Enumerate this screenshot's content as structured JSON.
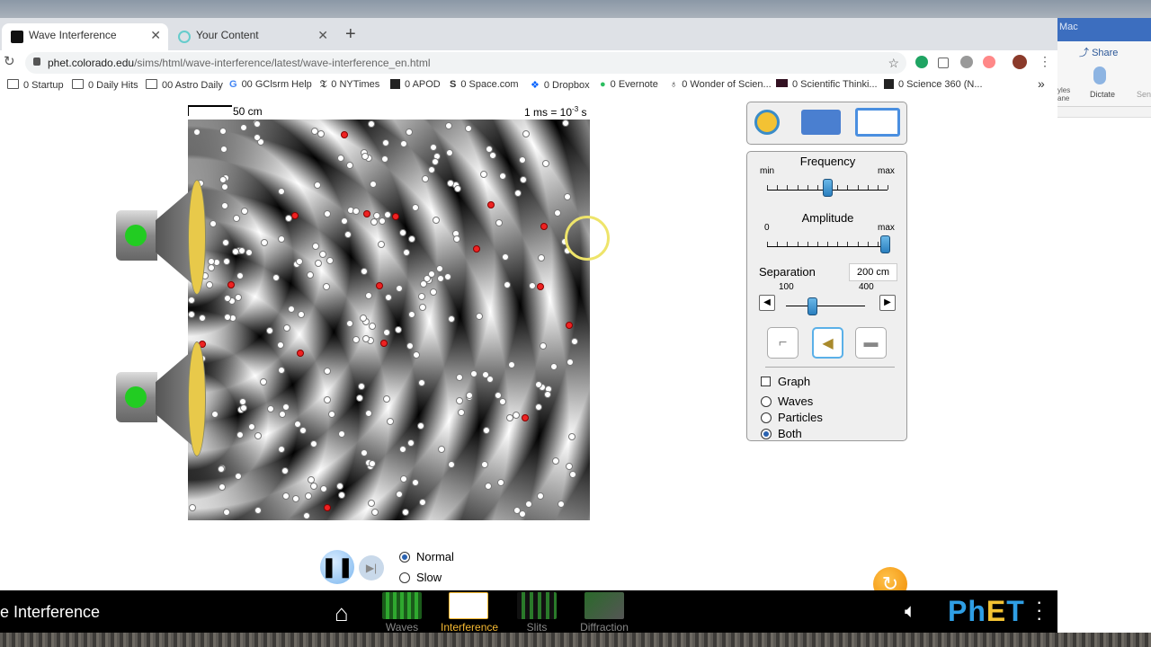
{
  "browser": {
    "tabs": [
      {
        "label": "Wave Interference",
        "active": true
      },
      {
        "label": "Your Content",
        "active": false
      }
    ],
    "url": {
      "domain": "phet.colorado.edu",
      "path": "/sims/html/wave-interference/latest/wave-interference_en.html"
    },
    "bookmarks": [
      "0 Startup",
      "0 Daily Hits",
      "00 Astro Daily",
      "00 GClsrm Help",
      "0 NYTimes",
      "0 APOD",
      "0 Space.com",
      "0 Dropbox",
      "0 Evernote",
      "0 Wonder of Scien...",
      "0 Scientific Thinki...",
      "0 Science 360 (N..."
    ]
  },
  "side_window": {
    "title": "Mac",
    "share": "Share",
    "dictate": "Dictate",
    "styles": "yles ane",
    "sensitivity": "Sen"
  },
  "sim": {
    "scale_label": "50 cm",
    "time_label": "1 ms = 10",
    "time_exp": "-3",
    "time_unit": " s",
    "frequency": {
      "title": "Frequency",
      "min": "min",
      "max": "max",
      "level": 0.5
    },
    "amplitude": {
      "title": "Amplitude",
      "min": "0",
      "max": "max",
      "level": 1.0
    },
    "separation": {
      "title": "Separation",
      "value": "200 cm",
      "min": "100",
      "max": "400",
      "level": 0.33
    },
    "options": {
      "graph": "Graph",
      "waves": "Waves",
      "particles": "Particles",
      "both": "Both",
      "selected": "both"
    },
    "speed": {
      "normal": "Normal",
      "slow": "Slow",
      "selected": "normal"
    }
  },
  "navbar": {
    "title": "e Interference",
    "screens": [
      "Waves",
      "Interference",
      "Slits",
      "Diffraction"
    ],
    "selected": "Interference",
    "brand": "PhET"
  },
  "colors": {
    "accent": "#f5b932",
    "thumb": "#2a7fbf",
    "source_green": "#22cc22"
  }
}
